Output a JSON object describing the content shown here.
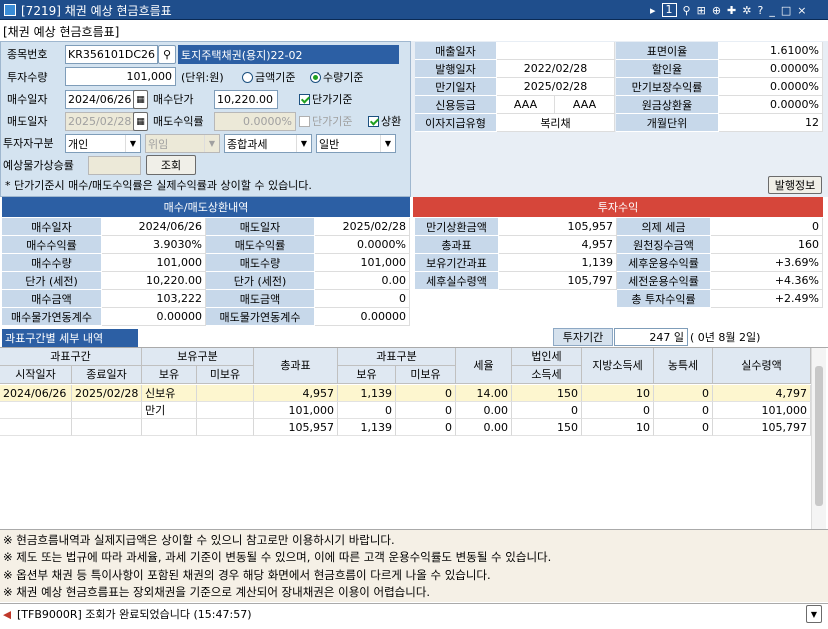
{
  "window": {
    "title": "[7219] 채권 예상 현금흐름표",
    "page_num": "1"
  },
  "sub_title": "[채권 예상 현금흐름표]",
  "form": {
    "code_label": "종목번호",
    "code_value": "KR356101DC26",
    "code_name": "토지주택채권(용지)22-02",
    "qty_label": "투자수량",
    "qty_value": "101,000",
    "qty_unit": "(단위:원)",
    "radio_amount": "금액기준",
    "radio_qty": "수량기준",
    "buy_date_label": "매수일자",
    "buy_date": "2024/06/26",
    "buy_price_label": "매수단가",
    "buy_price": "10,220.00",
    "unit_price_chk": "단가기준",
    "sell_date_label": "매도일자",
    "sell_date": "2025/02/28",
    "sell_yield_label": "매도수익률",
    "sell_yield": "0.0000%",
    "unit_price_chk2": "단가기준",
    "redeem_chk": "상환",
    "investor_label": "투자자구분",
    "investor": "개인",
    "delegate": "위임",
    "tax_type": "종합과세",
    "kind": "일반",
    "inflation_label": "예상물가상승률",
    "search_btn": "조회",
    "note": "* 단가기준시 매수/매도수익률은 실제수익률과 상이할 수 있습니다.",
    "issue_info_btn": "발행정보"
  },
  "bond_info": [
    [
      "매출일자",
      "",
      "표면이율",
      "1.6100%"
    ],
    [
      "발행일자",
      "2022/02/28",
      "할인율",
      "0.0000%"
    ],
    [
      "만기일자",
      "2025/02/28",
      "만기보장수익률",
      "0.0000%"
    ],
    [
      "신용등급",
      "AAA",
      "원금상환율",
      "0.0000%"
    ],
    [
      "이자지급유형",
      "복리채",
      "개월단위",
      "12"
    ]
  ],
  "bond_info_extra_rating": "AAA",
  "trade_panel": {
    "title": "매수/매도상환내역",
    "rows": [
      [
        "매수일자",
        "2024/06/26",
        "매도일자",
        "2025/02/28"
      ],
      [
        "매수수익률",
        "3.9030%",
        "매도수익률",
        "0.0000%"
      ],
      [
        "매수수량",
        "101,000",
        "매도수량",
        "101,000"
      ],
      [
        "단가 (세전)",
        "10,220.00",
        "단가 (세전)",
        "0.00"
      ],
      [
        "매수금액",
        "103,222",
        "매도금액",
        "0"
      ],
      [
        "매수물가연동계수",
        "0.00000",
        "매도물가연동계수",
        "0.00000"
      ]
    ]
  },
  "invest_panel": {
    "title": "투자수익",
    "rows": [
      [
        "만기상환금액",
        "105,957",
        "의제 세금",
        "0"
      ],
      [
        "총과표",
        "4,957",
        "원천징수금액",
        "160"
      ],
      [
        "보유기간과표",
        "1,139",
        "세후운용수익률",
        "+3.69%"
      ],
      [
        "세후실수령액",
        "105,797",
        "세전운용수익률",
        "+4.36%"
      ],
      [
        "",
        "",
        "총 투자수익률",
        "+2.49%"
      ]
    ]
  },
  "detail": {
    "tab": "과표구간별 세부 내역",
    "period_label": "투자기간",
    "period_days": "247 일",
    "period_text": "( 0년 8월 2일)",
    "headers": {
      "tax_range": "과표구간",
      "hold_type": "보유구분",
      "total_base": "총과표",
      "tax_type": "과표구분",
      "rate": "세율",
      "corp_tax": "법인세",
      "income_tax": "소득세",
      "local_tax": "지방소득세",
      "farm_tax": "농특세",
      "net_amount": "실수령액",
      "start": "시작일자",
      "end": "종료일자",
      "hold": "보유",
      "nonhold": "미보유",
      "hold2": "보유",
      "nonhold2": "미보유"
    },
    "rows": [
      [
        "2024/06/26",
        "2025/02/28",
        "신보유",
        "",
        "4,957",
        "1,139",
        "0",
        "14.00",
        "150",
        "10",
        "0",
        "4,797"
      ],
      [
        "",
        "",
        "만기",
        "",
        "101,000",
        "0",
        "0",
        "0.00",
        "0",
        "0",
        "0",
        "101,000"
      ],
      [
        "",
        "",
        "",
        "",
        "105,957",
        "1,139",
        "0",
        "0.00",
        "150",
        "10",
        "0",
        "105,797"
      ]
    ]
  },
  "notes": [
    "※ 현금흐름내역과 실제지급액은 상이할 수 있으니 참고로만 이용하시기 바랍니다.",
    "※ 제도 또는 법규에 따라 과세율, 과세 기준이 변동될 수 있으며, 이에 따른 고객 운용수익률도 변동될 수 있습니다.",
    "※ 옵션부 채권 등 특이사항이 포함된 채권의 경우 해당 화면에서 현금흐름이 다르게 나올 수 있습니다.",
    "※ 채권 예상 현금흐름표는 장외채권을 기준으로 계산되어 장내채권은 이용이 어렵습니다."
  ],
  "status": "[TFB9000R] 조회가 완료되었습니다 (15:47:57)"
}
